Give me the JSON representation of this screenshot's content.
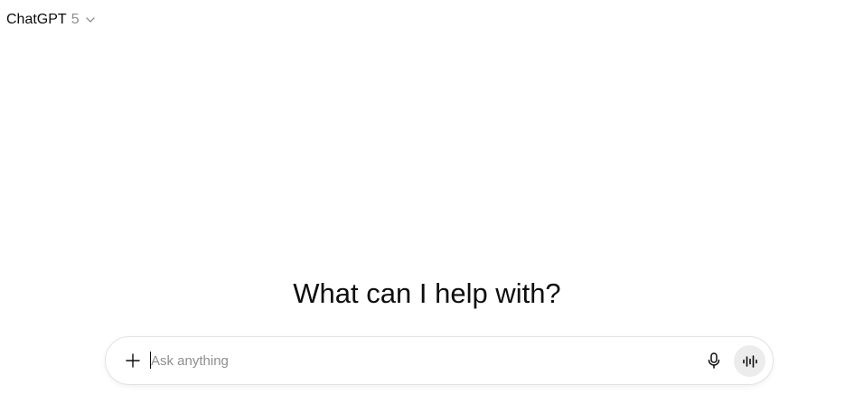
{
  "header": {
    "model_name": "ChatGPT",
    "model_version": "5",
    "chevron_icon": "chevron-down-icon"
  },
  "main": {
    "headline": "What can I help with?"
  },
  "composer": {
    "placeholder": "Ask anything",
    "value": "",
    "add_icon": "plus-icon",
    "dictate_icon": "microphone-icon",
    "voice_icon": "voice-waveform-icon"
  },
  "colors": {
    "text": "#0d0d0d",
    "muted": "#8f8f8f",
    "composer_border": "#e3e3e3",
    "voice_button_bg": "#ececec"
  }
}
